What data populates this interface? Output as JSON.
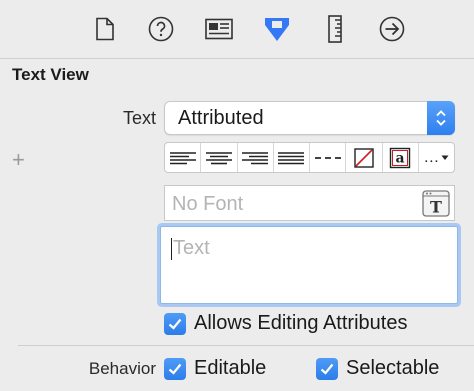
{
  "toolbar": {
    "tabs": [
      {
        "icon": "file-icon"
      },
      {
        "icon": "help-icon"
      },
      {
        "icon": "identity-icon"
      },
      {
        "icon": "attributes-icon",
        "selected": true
      },
      {
        "icon": "size-ruler-icon"
      },
      {
        "icon": "connections-arrow-icon"
      }
    ],
    "accent": "#3478f6"
  },
  "section": {
    "title": "Text View"
  },
  "text_row": {
    "label": "Text",
    "popup_value": "Attributed"
  },
  "format_bar": {
    "buttons": [
      "align-left",
      "align-center",
      "align-right",
      "justify",
      "natural",
      "no-color",
      "text-color",
      "more"
    ],
    "more_label": "…",
    "text_color_glyph": "a"
  },
  "font_field": {
    "placeholder": "No Font"
  },
  "text_area": {
    "placeholder": "Text"
  },
  "allows_editing": {
    "label": "Allows Editing Attributes",
    "checked": true
  },
  "behavior": {
    "label": "Behavior",
    "editable_label": "Editable",
    "editable_checked": true,
    "selectable_label": "Selectable",
    "selectable_checked": true
  }
}
